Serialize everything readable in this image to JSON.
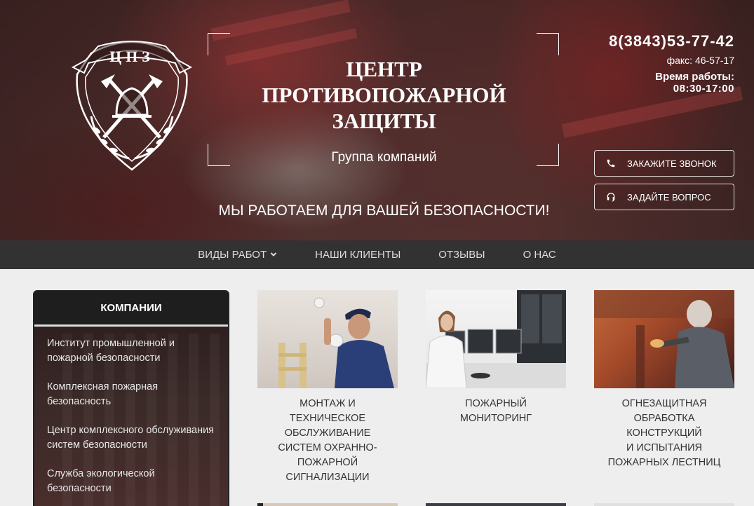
{
  "logo": {
    "text": "ЦПЗ"
  },
  "header": {
    "title_lines": [
      "ЦЕНТР",
      "ПРОТИВОПОЖАРНОЙ",
      "ЗАЩИТЫ"
    ],
    "subtitle": "Группа компаний",
    "slogan": "МЫ РАБОТАЕМ ДЛЯ ВАШЕЙ БЕЗОПАСНОСТИ!",
    "phone": "8(3843)53-77-42",
    "fax": "факс: 46-57-17",
    "hours_label": "Время работы:",
    "hours": "08:30-17:00",
    "call_button": "ЗАКАЖИТЕ ЗВОНОК",
    "ask_button": "ЗАДАЙТЕ ВОПРОС"
  },
  "nav": {
    "items": [
      "ВИДЫ РАБОТ",
      "НАШИ КЛИЕНТЫ",
      "ОТЗЫВЫ",
      "О НАС"
    ]
  },
  "sidebar": {
    "title": "КОМПАНИИ",
    "items": [
      "Институт промышленной и пожарной безопасности",
      "Комплексная пожарная безопасность",
      "Центр комплексного обслуживания систем безопасности",
      "Служба экологической безопасности"
    ]
  },
  "cards": [
    {
      "lines": [
        "МОНТАЖ И",
        "ТЕХНИЧЕСКОЕ",
        "ОБСЛУЖИВАНИЕ",
        "СИСТЕМ ОХРАННО-",
        "ПОЖАРНОЙ",
        "СИГНАЛИЗАЦИИ"
      ]
    },
    {
      "lines": [
        "ПОЖАРНЫЙ",
        "МОНИТОРИНГ"
      ]
    },
    {
      "lines": [
        "ОГНЕЗАЩИТНАЯ",
        "ОБРАБОТКА",
        "КОНСТРУКЦИЙ",
        "И ИСПЫТАНИЯ",
        "ПОЖАРНЫХ ЛЕСТНИЦ"
      ]
    }
  ]
}
